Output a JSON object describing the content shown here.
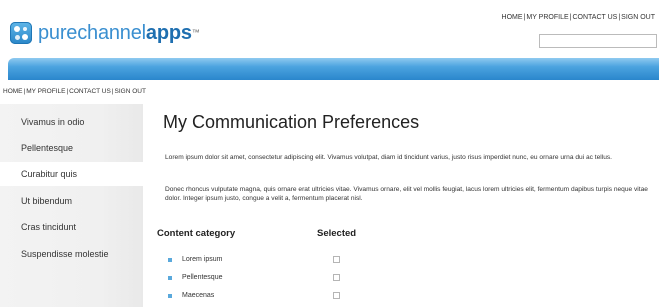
{
  "brand": {
    "name_part1": "purechannel",
    "name_part2": "apps",
    "trademark": "™"
  },
  "top_nav": {
    "links": [
      "HOME",
      "MY PROFILE",
      "CONTACT US",
      "SIGN OUT"
    ],
    "separator": "|"
  },
  "search": {
    "value": ""
  },
  "breadcrumb": {
    "links": [
      "HOME",
      "MY PROFILE",
      "CONTACT US",
      "SIGN OUT"
    ],
    "separator": "|"
  },
  "sidebar": {
    "items": [
      {
        "label": "Vivamus in odio",
        "active": false
      },
      {
        "label": "Pellentesque",
        "active": false
      },
      {
        "label": "Curabitur quis",
        "active": true
      },
      {
        "label": "Ut bibendum",
        "active": false
      },
      {
        "label": "Cras tincidunt",
        "active": false
      },
      {
        "label": "Suspendisse molestie",
        "active": false
      }
    ]
  },
  "main": {
    "title": "My Communication Preferences",
    "paragraph1": "Lorem ipsum dolor sit amet, consectetur adipiscing elit. Vivamus volutpat, diam id tincidunt varius, justo risus imperdiet nunc, eu ornare urna dui ac tellus.",
    "paragraph2": "Donec rhoncus vulputate magna, quis ornare erat ultricies vitae. Vivamus ornare, elit vel mollis feugiat, lacus lorem ultricies elit, fermentum dapibus turpis neque vitae dolor. Integer ipsum justo, congue a velit a, fermentum placerat nisl.",
    "table": {
      "headers": [
        "Content category",
        "Selected"
      ],
      "rows": [
        {
          "label": "Lorem ipsum",
          "selected": false
        },
        {
          "label": "Pellentesque",
          "selected": false
        },
        {
          "label": "Maecenas",
          "selected": false
        }
      ]
    }
  },
  "colors": {
    "accent": "#2a86cc",
    "bullet": "#5aa9dc",
    "sidebar_bg": "#f0f0f0"
  }
}
